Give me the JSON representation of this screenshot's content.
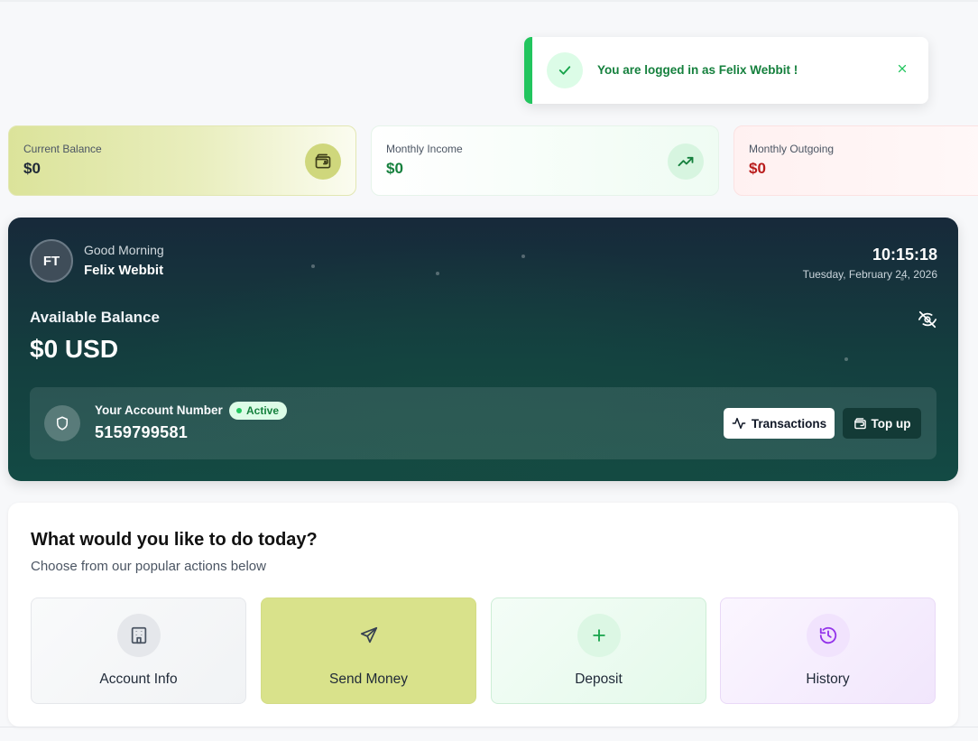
{
  "toast": {
    "message": "You are logged in as Felix Webbit !",
    "accent_color": "#22c55e",
    "icon": "check-icon",
    "close_icon": "close-icon"
  },
  "stats": {
    "balance": {
      "label": "Current Balance",
      "value": "$0",
      "icon": "wallet-icon"
    },
    "income": {
      "label": "Monthly Income",
      "value": "$0",
      "icon": "trending-up-icon"
    },
    "outgoing": {
      "label": "Monthly Outgoing",
      "value": "$0"
    }
  },
  "hero": {
    "avatar_initials": "FT",
    "greeting": "Good Morning",
    "user_name": "Felix Webbit",
    "time": "10:15:18",
    "date": "Tuesday, February 24, 2026",
    "available_label": "Available Balance",
    "available_amount": "$0 USD",
    "account": {
      "label": "Your Account Number",
      "status": "Active",
      "number": "5159799581"
    },
    "buttons": {
      "transactions": "Transactions",
      "topup": "Top up"
    }
  },
  "actions": {
    "title": "What would you like to do today?",
    "subtitle": "Choose from our popular actions below",
    "items": [
      {
        "label": "Account Info",
        "icon": "building-icon"
      },
      {
        "label": "Send Money",
        "icon": "send-icon"
      },
      {
        "label": "Deposit",
        "icon": "plus-icon"
      },
      {
        "label": "History",
        "icon": "history-icon"
      }
    ]
  },
  "colors": {
    "income_green": "#15803d",
    "outgoing_red": "#b91c1c",
    "hero_dark": "#17293a",
    "send_tile": "#d9e28b"
  }
}
